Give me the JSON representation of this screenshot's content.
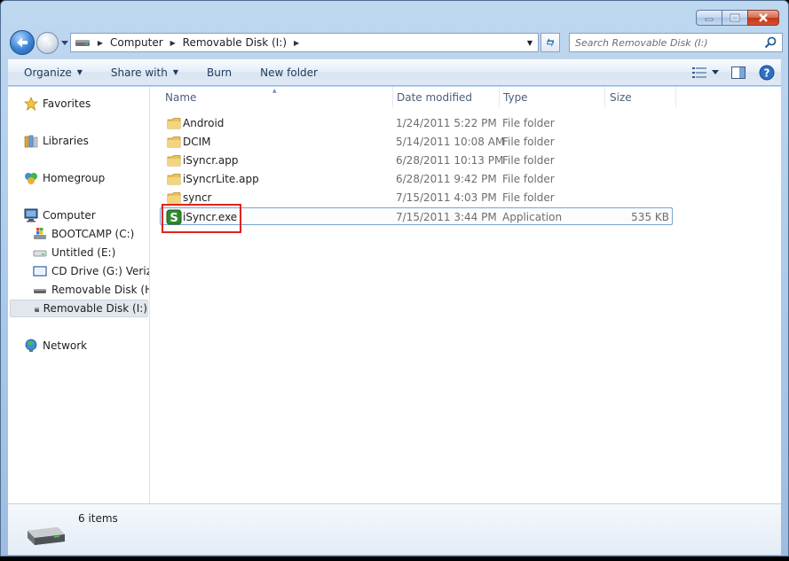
{
  "window": {
    "address": [
      "Computer",
      "Removable Disk (I:)"
    ],
    "search_placeholder": "Search Removable Disk (I:)"
  },
  "toolbar": {
    "organize": "Organize",
    "share_with": "Share with",
    "burn": "Burn",
    "new_folder": "New folder"
  },
  "nav": {
    "favorites": "Favorites",
    "libraries": "Libraries",
    "homegroup": "Homegroup",
    "computer": "Computer",
    "drives": [
      {
        "label": "BOOTCAMP (C:)",
        "icon": "windows-drive-icon"
      },
      {
        "label": "Untitled (E:)",
        "icon": "drive-icon"
      },
      {
        "label": "CD Drive (G:) Verizon",
        "icon": "cd-drive-icon"
      },
      {
        "label": "Removable Disk (H:)",
        "icon": "removable-disk-icon"
      },
      {
        "label": "Removable Disk (I:)",
        "icon": "removable-disk-icon",
        "selected": true
      }
    ],
    "network": "Network"
  },
  "columns": {
    "name": "Name",
    "date": "Date modified",
    "type": "Type",
    "size": "Size"
  },
  "files": [
    {
      "name": "Android",
      "date": "1/24/2011 5:22 PM",
      "type": "File folder",
      "size": "",
      "icon": "folder-icon"
    },
    {
      "name": "DCIM",
      "date": "5/14/2011 10:08 AM",
      "type": "File folder",
      "size": "",
      "icon": "folder-icon"
    },
    {
      "name": "iSyncr.app",
      "date": "6/28/2011 10:13 PM",
      "type": "File folder",
      "size": "",
      "icon": "folder-icon"
    },
    {
      "name": "iSyncrLite.app",
      "date": "6/28/2011 9:42 PM",
      "type": "File folder",
      "size": "",
      "icon": "folder-icon"
    },
    {
      "name": "syncr",
      "date": "7/15/2011 4:03 PM",
      "type": "File folder",
      "size": "",
      "icon": "folder-icon"
    },
    {
      "name": "iSyncr.exe",
      "date": "7/15/2011 3:44 PM",
      "type": "Application",
      "size": "535 KB",
      "icon": "isyncr-app-icon",
      "selected": true
    }
  ],
  "details": {
    "count": "6 items"
  },
  "colors": {
    "highlight": "#e0231f",
    "folder": "#e9c25a",
    "app_green": "#2f8a2c"
  }
}
